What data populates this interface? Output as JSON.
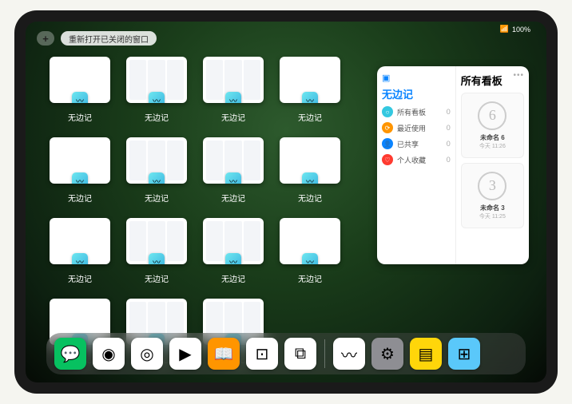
{
  "status": {
    "wifi": "📶",
    "battery": "100%"
  },
  "top": {
    "plus": "+",
    "reopen": "重新打开已关闭的窗口"
  },
  "grid": {
    "app_label": "无边记",
    "items": [
      {
        "blank": true
      },
      {
        "blank": false
      },
      {
        "blank": false
      },
      {
        "blank": true
      },
      {
        "blank": true
      },
      {
        "blank": false
      },
      {
        "blank": false
      },
      {
        "blank": true
      },
      {
        "blank": true
      },
      {
        "blank": false
      },
      {
        "blank": false
      },
      {
        "blank": true
      },
      {
        "blank": true
      },
      {
        "blank": false
      },
      {
        "blank": false
      }
    ]
  },
  "panel": {
    "left_title": "无边记",
    "right_title": "所有看板",
    "more": "•••",
    "items": [
      {
        "icon": "○",
        "color": "#34c8e0",
        "label": "所有看板",
        "count": "0"
      },
      {
        "icon": "⟳",
        "color": "#ff9500",
        "label": "最近使用",
        "count": "0"
      },
      {
        "icon": "👤",
        "color": "#0a84ff",
        "label": "已共享",
        "count": "0"
      },
      {
        "icon": "♡",
        "color": "#ff3b30",
        "label": "个人收藏",
        "count": "0"
      }
    ],
    "boards": [
      {
        "sketch": "6",
        "name": "未命名 6",
        "time": "今天 11:26"
      },
      {
        "sketch": "3",
        "name": "未命名 3",
        "time": "今天 11:25"
      }
    ]
  },
  "dock": {
    "icons": [
      {
        "name": "wechat",
        "bg": "#07c160",
        "glyph": "💬"
      },
      {
        "name": "quark-hd",
        "bg": "#fff",
        "glyph": "◉"
      },
      {
        "name": "quark",
        "bg": "#fff",
        "glyph": "◎"
      },
      {
        "name": "play",
        "bg": "#fff",
        "glyph": "▶"
      },
      {
        "name": "books",
        "bg": "#ff9500",
        "glyph": "📖"
      },
      {
        "name": "dice",
        "bg": "#fff",
        "glyph": "⊡"
      },
      {
        "name": "connect",
        "bg": "#fff",
        "glyph": "⧉"
      }
    ],
    "recent": [
      {
        "name": "freeform",
        "bg": "#fff",
        "glyph": "〰"
      },
      {
        "name": "settings",
        "bg": "#8e8e93",
        "glyph": "⚙"
      },
      {
        "name": "notes",
        "bg": "#ffd60a",
        "glyph": "▤"
      },
      {
        "name": "folder",
        "bg": "#5ac8fa",
        "glyph": "⊞"
      }
    ]
  }
}
